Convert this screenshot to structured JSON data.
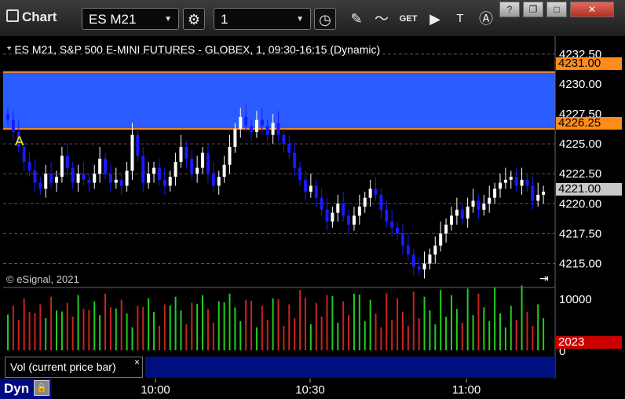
{
  "toolbar": {
    "app_title": "Chart",
    "symbol": "ES M21",
    "interval": "1",
    "icons": [
      "gear-icon",
      "clock-icon",
      "pencil-icon",
      "study-icon",
      "get-icon",
      "play-icon",
      "text-icon",
      "alert-icon"
    ],
    "window_buttons": [
      "?",
      "❐",
      "□",
      "✕"
    ]
  },
  "chart": {
    "title": "* ES M21, S&P 500 E-MINI FUTURES - GLOBEX, 1, 09:30-16:15 (Dynamic)",
    "copyright": "© eSignal, 2021",
    "marker": "A",
    "price_ticks": [
      "4232.50",
      "4230.00",
      "4227.50",
      "4225.00",
      "4222.50",
      "4220.00",
      "4217.50",
      "4215.00"
    ],
    "time_ticks": [
      "10:00",
      "10:30",
      "11:00"
    ],
    "band_top_label": "4231.00",
    "band_bottom_label": "4226.25",
    "last_price_label": "4221.00",
    "volume_ticks": [
      "10000",
      "0"
    ],
    "volume_label": "2023",
    "colors": {
      "band": "#2b5cff",
      "band_line": "#ff8c1a",
      "up": "#ffffff",
      "down": "#1a1aff",
      "vol_up": "#22cc22",
      "vol_down": "#cc2222",
      "last_tag": "#c8c8c8",
      "vol_tag": "#cc0000"
    }
  },
  "volume_panel": {
    "label": "Vol (current price bar)",
    "close": "×"
  },
  "statusbar": {
    "dyn": "Dyn"
  },
  "chart_data": {
    "type": "candlestick",
    "title": "* ES M21, S&P 500 E-MINI FUTURES - GLOBEX, 1, 09:30-16:15 (Dynamic)",
    "y_range": [
      4213.0,
      4234.0
    ],
    "y_ticks": [
      4232.5,
      4230.0,
      4227.5,
      4225.0,
      4222.5,
      4220.0,
      4217.5,
      4215.0
    ],
    "x_ticks": [
      "10:00",
      "10:30",
      "11:00"
    ],
    "band": [
      4226.25,
      4231.0
    ],
    "last_price": 4221.0,
    "closes": [
      4227.0,
      4226.0,
      4224.75,
      4223.5,
      4222.75,
      4221.75,
      4221.25,
      4222.5,
      4221.75,
      4222.25,
      4224.0,
      4223.0,
      4221.75,
      4222.5,
      4222.0,
      4221.75,
      4222.5,
      4223.75,
      4222.5,
      4221.75,
      4222.0,
      4221.5,
      4222.75,
      4225.75,
      4224.0,
      4221.75,
      4222.5,
      4223.0,
      4222.0,
      4221.5,
      4222.25,
      4223.5,
      4224.75,
      4223.75,
      4222.5,
      4223.0,
      4224.25,
      4222.5,
      4221.5,
      4222.25,
      4223.25,
      4224.75,
      4226.25,
      4227.25,
      4226.5,
      4226.0,
      4227.0,
      4226.5,
      4225.75,
      4226.75,
      4225.75,
      4225.0,
      4224.25,
      4223.0,
      4222.0,
      4221.0,
      4221.5,
      4220.5,
      4219.5,
      4218.5,
      4219.25,
      4220.0,
      4219.0,
      4218.25,
      4219.0,
      4219.75,
      4220.5,
      4221.25,
      4220.75,
      4219.5,
      4218.5,
      4218.0,
      4217.5,
      4216.5,
      4215.75,
      4214.75,
      4214.5,
      4215.0,
      4215.75,
      4216.5,
      4217.5,
      4218.25,
      4219.0,
      4219.5,
      4218.75,
      4219.75,
      4220.25,
      4219.5,
      4220.0,
      4220.5,
      4221.25,
      4221.75,
      4222.0,
      4222.25,
      4221.5,
      4222.0,
      4221.5,
      4220.25,
      4220.75,
      4221.0
    ],
    "volume": {
      "max": 12000,
      "tick": 10000,
      "last": 2023
    }
  }
}
